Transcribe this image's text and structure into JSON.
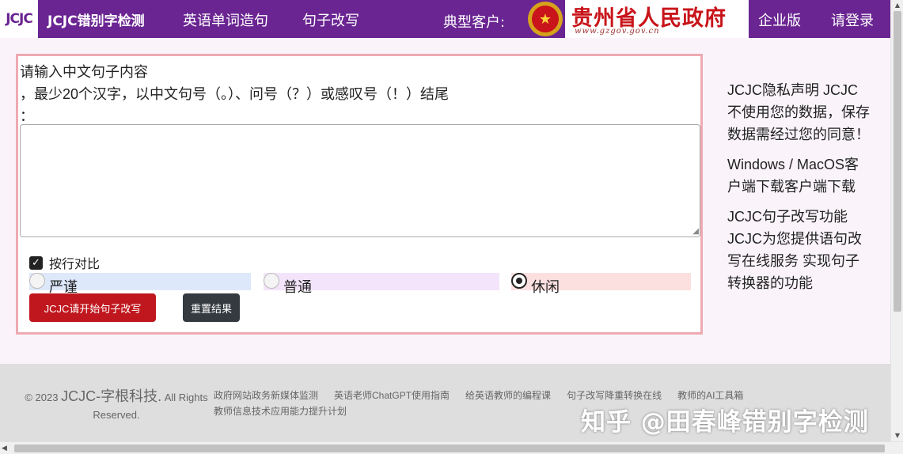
{
  "header": {
    "logo_text": "JCJC",
    "brand": "JCJC错别字检测",
    "nav_items": [
      "英语单词造句",
      "句子改写"
    ],
    "customer_label": "典型客户:",
    "gov_name": "贵州省人民政府",
    "gov_url": "www.gzgov.gov.cn",
    "enterprise": "企业版",
    "login": "请登录"
  },
  "form": {
    "label_line1": "请输入中文句子内容",
    "label_line2": "，最少20个汉字，以中文句号（。）、问号（？）或感叹号（！）结尾",
    "label_line3": "：",
    "textarea_value": "",
    "compare_label": "按行对比",
    "compare_checked": true,
    "modes": [
      {
        "label": "严谨",
        "selected": false
      },
      {
        "label": "普通",
        "selected": false
      },
      {
        "label": "休闲",
        "selected": true
      }
    ],
    "start_button": "JCJC请开始句子改写",
    "reset_button": "重置结果"
  },
  "side": {
    "privacy": "JCJC隐私声明 JCJC不使用您的数据，保存数据需经过您的同意！",
    "client": "Windows / MacOS客户端下载客户端下载",
    "rewrite": "JCJC句子改写功能 JCJC为您提供语句改写在线服务 实现句子转换器的功能"
  },
  "footer": {
    "copyright_prefix": "© 2023",
    "copyright_name": "JCJC-字根科技.",
    "copyright_suffix": "All Rights Reserved.",
    "links": [
      "政府网站政务新媒体监测",
      "英语老师ChatGPT使用指南",
      "给英语教师的编程课",
      "句子改写降重转换在线",
      "教师的AI工具箱",
      "教师信息技术应用能力提升计划"
    ],
    "watermark": "知乎 @田春峰错别字检测"
  },
  "colors": {
    "header_bg": "#6a2592",
    "panel_border": "#eeaab2",
    "start_button": "#c0171f",
    "reset_button": "#343a40",
    "footer_bg": "#dedede"
  },
  "icons": [
    "national-emblem-icon",
    "checkbox-checked-icon",
    "radio-icon",
    "resize-grip-icon"
  ]
}
